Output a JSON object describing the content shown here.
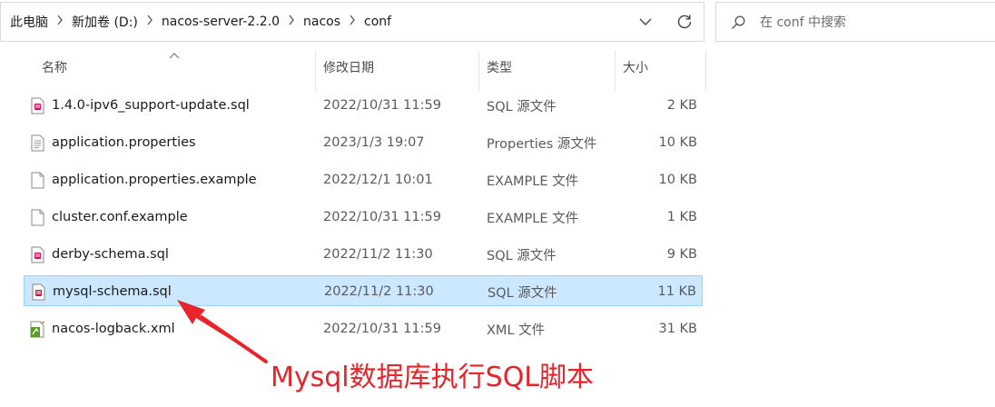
{
  "address_bar": {
    "breadcrumbs": [
      "此电脑",
      "新加卷 (D:)",
      "nacos-server-2.2.0",
      "nacos",
      "conf"
    ],
    "separator_icon": "chevron-right-icon",
    "dropdown_icon": "chevron-down-icon",
    "refresh_icon": "refresh-icon"
  },
  "search": {
    "placeholder": "在 conf 中搜索",
    "icon": "search-icon"
  },
  "columns": {
    "name": "名称",
    "modified": "修改日期",
    "type": "类型",
    "size": "大小",
    "sort_indicator": "sort-ascending-icon"
  },
  "files": [
    {
      "name": "1.4.0-ipv6_support-update.sql",
      "modified": "2022/10/31 11:59",
      "type": "SQL 源文件",
      "size": "2 KB",
      "icon": "sql-file-icon",
      "selected": false
    },
    {
      "name": "application.properties",
      "modified": "2023/1/3 19:07",
      "type": "Properties 源文件",
      "size": "10 KB",
      "icon": "properties-file-icon",
      "selected": false
    },
    {
      "name": "application.properties.example",
      "modified": "2022/12/1 10:01",
      "type": "EXAMPLE 文件",
      "size": "10 KB",
      "icon": "blank-file-icon",
      "selected": false
    },
    {
      "name": "cluster.conf.example",
      "modified": "2022/10/31 11:59",
      "type": "EXAMPLE 文件",
      "size": "1 KB",
      "icon": "blank-file-icon",
      "selected": false
    },
    {
      "name": "derby-schema.sql",
      "modified": "2022/11/2 11:30",
      "type": "SQL 源文件",
      "size": "9 KB",
      "icon": "sql-file-icon",
      "selected": false
    },
    {
      "name": "mysql-schema.sql",
      "modified": "2022/11/2 11:30",
      "type": "SQL 源文件",
      "size": "11 KB",
      "icon": "sql-file-icon",
      "selected": true
    },
    {
      "name": "nacos-logback.xml",
      "modified": "2022/10/31 11:59",
      "type": "XML 文件",
      "size": "31 KB",
      "icon": "xml-file-icon",
      "selected": false
    }
  ],
  "annotation": {
    "text": "Mysql数据库执行SQL脚本",
    "color": "#e8242a"
  },
  "colors": {
    "selection_bg": "#cce8ff",
    "selection_border": "#99d1ff"
  }
}
